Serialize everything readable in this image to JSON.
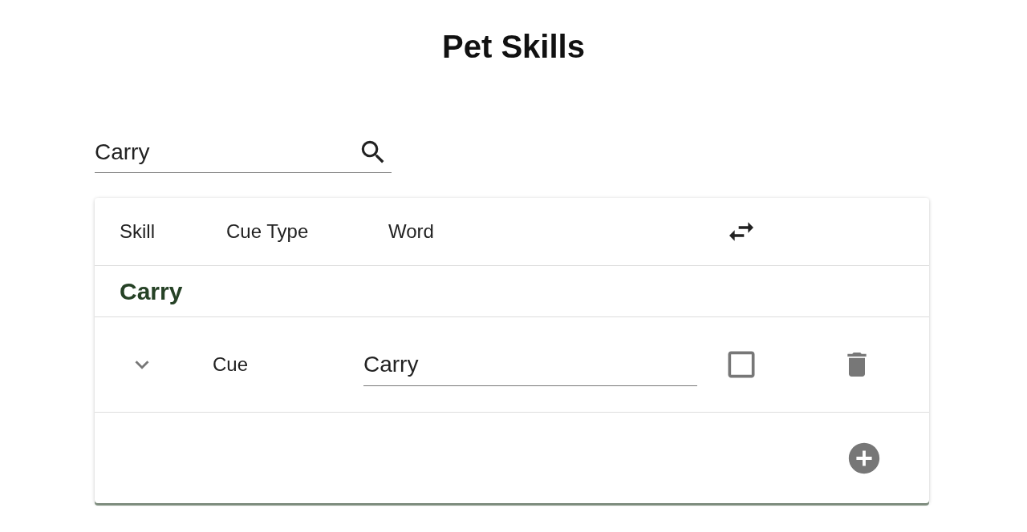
{
  "title": "Pet Skills",
  "search": {
    "value": "Carry"
  },
  "table": {
    "columns": [
      "Skill",
      "Cue Type",
      "Word"
    ],
    "groups": [
      {
        "name": "Carry",
        "rows": [
          {
            "expanded": false,
            "cue_type": "Cue",
            "word": "Carry",
            "checked": false
          }
        ]
      }
    ]
  }
}
